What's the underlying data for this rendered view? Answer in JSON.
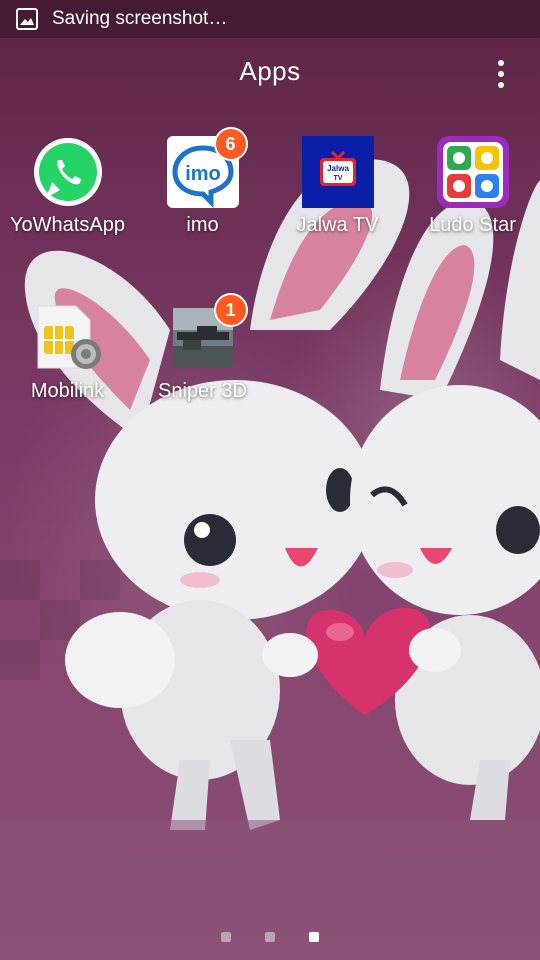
{
  "status_bar": {
    "text": "Saving screenshot…",
    "icon": "image-icon"
  },
  "header": {
    "title": "Apps",
    "menu_icon": "more-vertical-icon"
  },
  "apps": [
    {
      "label": "YoWhatsApp",
      "icon": "whatsapp-icon",
      "badge": ""
    },
    {
      "label": "imo",
      "icon": "imo-icon",
      "badge": "6"
    },
    {
      "label": "Jalwa TV",
      "icon": "jalwa-tv-icon",
      "badge": "",
      "icon_text": "Jalwa TV"
    },
    {
      "label": "Ludo Star",
      "icon": "ludo-star-icon",
      "badge": ""
    },
    {
      "label": "Mobilink",
      "icon": "sim-settings-icon",
      "badge": ""
    },
    {
      "label": "Sniper 3D",
      "icon": "sniper-3d-icon",
      "badge": "1"
    }
  ],
  "page_indicator": {
    "count": 3,
    "active": 3
  },
  "colors": {
    "badge": "#ff5a1f",
    "whatsapp": "#25d366",
    "jalwa_bg": "#0a1ea8"
  }
}
